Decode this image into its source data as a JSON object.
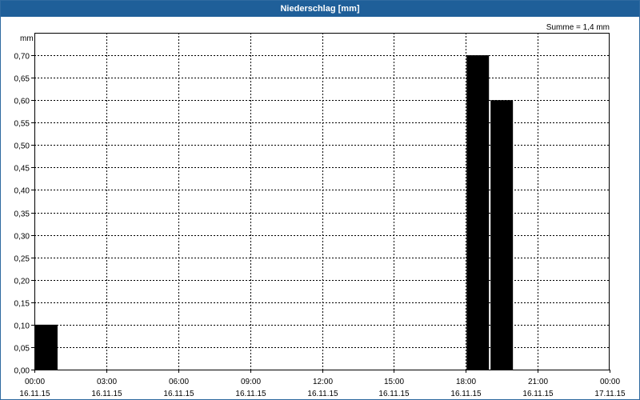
{
  "window": {
    "title": "Niederschlag [mm]"
  },
  "chart_data": {
    "type": "bar",
    "title": "Niederschlag [mm]",
    "ylabel": "mm",
    "summary": "Summe = 1,4 mm",
    "ylim": [
      0,
      0.75
    ],
    "y_ticks": [
      "0,00",
      "0,05",
      "0,10",
      "0,15",
      "0,20",
      "0,25",
      "0,30",
      "0,35",
      "0,40",
      "0,45",
      "0,50",
      "0,55",
      "0,60",
      "0,65",
      "0,70"
    ],
    "x_ticks": [
      {
        "time": "00:00",
        "date": "16.11.15"
      },
      {
        "time": "03:00",
        "date": "16.11.15"
      },
      {
        "time": "06:00",
        "date": "16.11.15"
      },
      {
        "time": "09:00",
        "date": "16.11.15"
      },
      {
        "time": "12:00",
        "date": "16.11.15"
      },
      {
        "time": "15:00",
        "date": "16.11.15"
      },
      {
        "time": "18:00",
        "date": "16.11.15"
      },
      {
        "time": "21:00",
        "date": "16.11.15"
      },
      {
        "time": "00:00",
        "date": "17.11.15"
      }
    ],
    "xlim": [
      "16.11.15 00:00",
      "17.11.15 00:00"
    ],
    "bar_interval": "1h",
    "bars": [
      {
        "start": "16.11.15 00:00",
        "end": "16.11.15 01:00",
        "value": 0.1
      },
      {
        "start": "16.11.15 18:00",
        "end": "16.11.15 19:00",
        "value": 0.7
      },
      {
        "start": "16.11.15 19:00",
        "end": "16.11.15 20:00",
        "value": 0.6
      }
    ],
    "grid": true,
    "bar_color": "#000000"
  }
}
